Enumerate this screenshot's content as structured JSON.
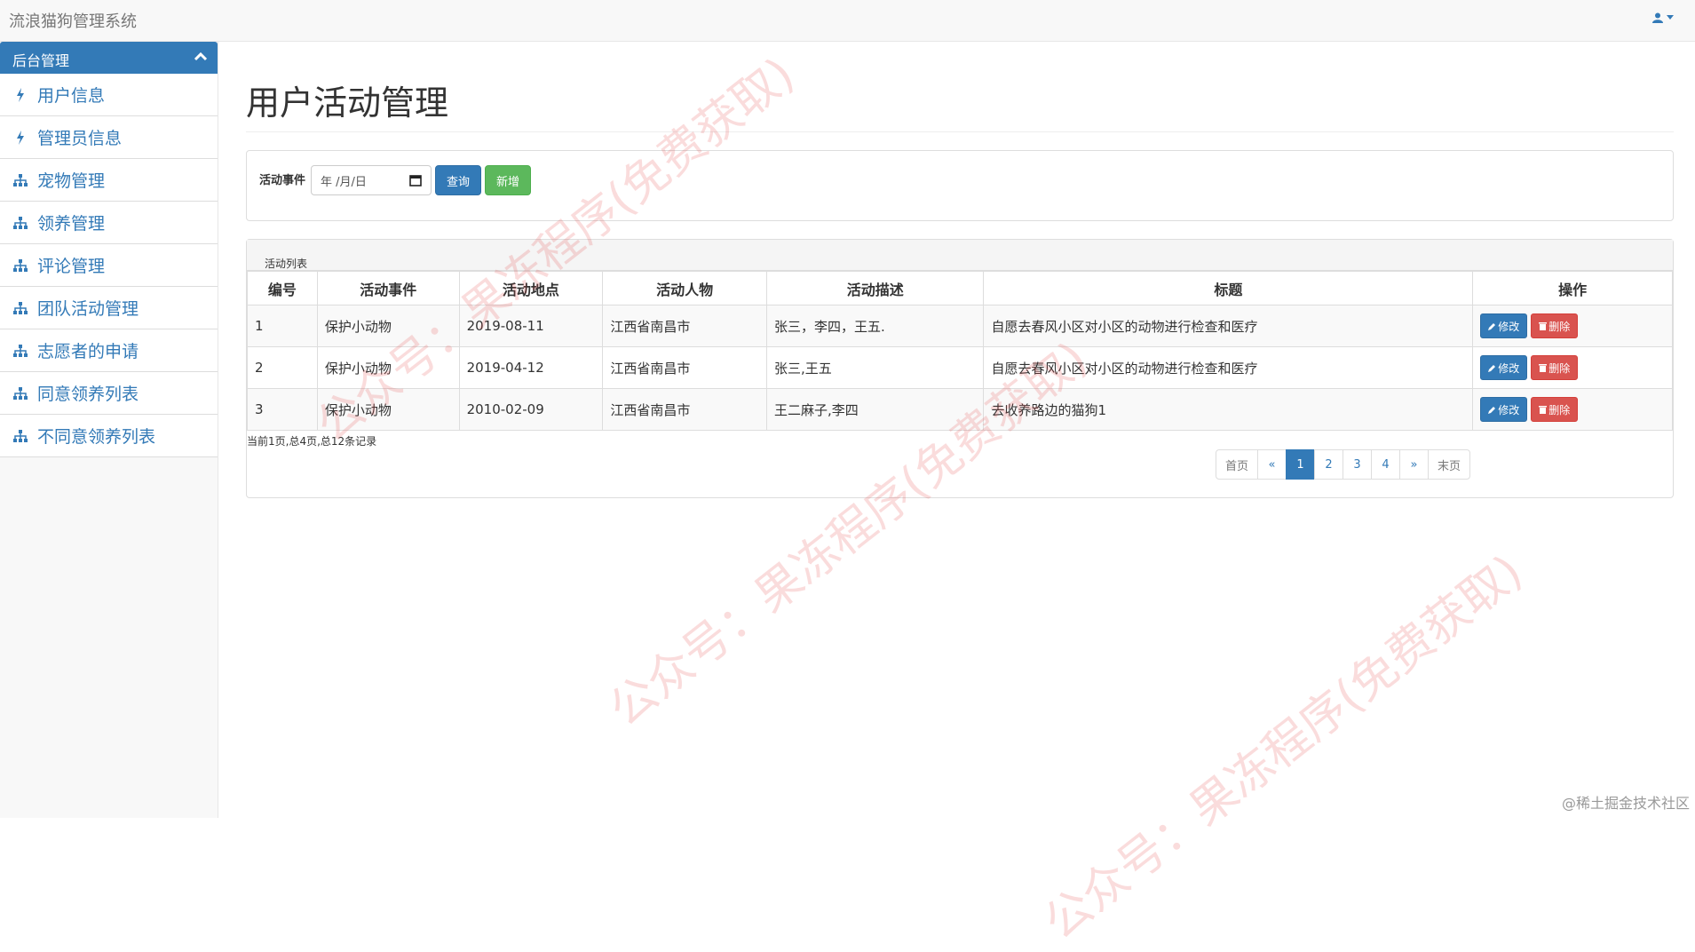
{
  "app": {
    "title": "流浪猫狗管理系统"
  },
  "sidebar": {
    "header": "后台管理",
    "items": [
      {
        "label": "用户信息",
        "icon": "bolt-icon"
      },
      {
        "label": "管理员信息",
        "icon": "bolt-icon"
      },
      {
        "label": "宠物管理",
        "icon": "sitemap-icon"
      },
      {
        "label": "领养管理",
        "icon": "sitemap-icon"
      },
      {
        "label": "评论管理",
        "icon": "sitemap-icon"
      },
      {
        "label": "团队活动管理",
        "icon": "sitemap-icon"
      },
      {
        "label": "志愿者的申请",
        "icon": "sitemap-icon"
      },
      {
        "label": "同意领养列表",
        "icon": "sitemap-icon"
      },
      {
        "label": "不同意领养列表",
        "icon": "sitemap-icon"
      }
    ]
  },
  "main": {
    "title": "用户活动管理",
    "query": {
      "label": "活动事件",
      "date_placeholder": "年 /月/日",
      "search_label": "查询",
      "add_label": "新增"
    },
    "list": {
      "heading": "活动列表",
      "columns": [
        "编号",
        "活动事件",
        "活动地点",
        "活动人物",
        "活动描述",
        "标题",
        "操作"
      ],
      "rows": [
        {
          "id": "1",
          "event": "保护小动物",
          "location": "2019-08-11",
          "people": "江西省南昌市",
          "desc": "张三，李四，王五.",
          "title": "自愿去春风小区对小区的动物进行检查和医疗"
        },
        {
          "id": "2",
          "event": "保护小动物",
          "location": "2019-04-12",
          "people": "江西省南昌市",
          "desc": "张三,王五",
          "title": "自愿去春风小区对小区的动物进行检查和医疗"
        },
        {
          "id": "3",
          "event": "保护小动物",
          "location": "2010-02-09",
          "people": "江西省南昌市",
          "desc": "王二麻子,李四",
          "title": "去收养路边的猫狗1"
        }
      ],
      "edit_label": "修改",
      "delete_label": "删除",
      "page_info": "当前1页,总4页,总12条记录"
    },
    "pagination": {
      "first": "首页",
      "prev": "«",
      "pages": [
        "1",
        "2",
        "3",
        "4"
      ],
      "current": "1",
      "next": "»",
      "last": "末页"
    }
  },
  "watermark": {
    "text1": "公众号：果冻程序(免费获取)",
    "corner": "@稀土掘金技术社区"
  },
  "colors": {
    "primary": "#337ab7",
    "success": "#5cb85c",
    "danger": "#d9534f"
  }
}
